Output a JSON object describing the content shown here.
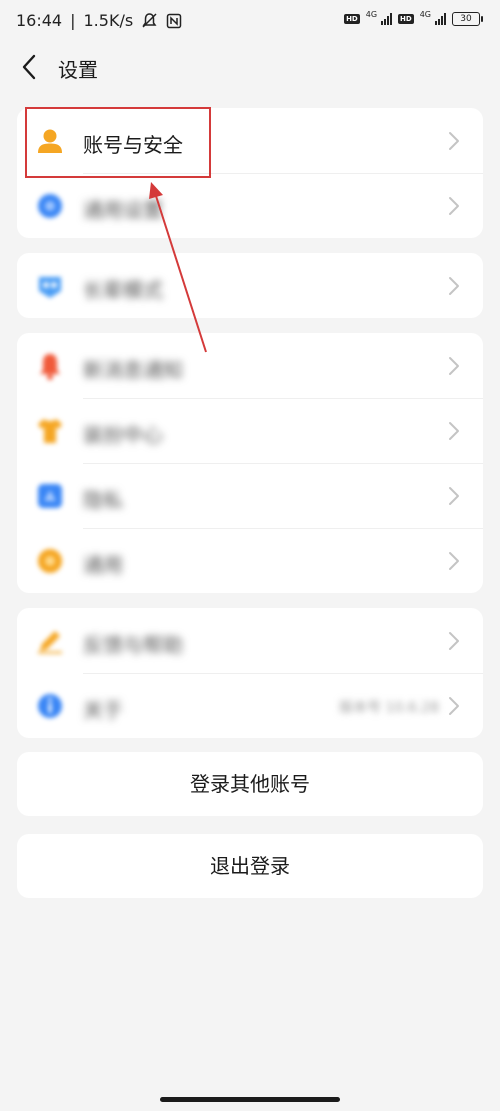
{
  "status_bar": {
    "time": "16:44",
    "speed": "1.5K/s",
    "hd1": "HD",
    "net1": "4G",
    "hd2": "HD",
    "net2": "4G",
    "battery": "30"
  },
  "header": {
    "title": "设置",
    "back_icon": "chevron-left-icon"
  },
  "groups": [
    {
      "items": [
        {
          "label": "账号与安全",
          "icon": "person-icon",
          "color": "#f5a623",
          "blurred": false
        },
        {
          "label": "通用设置",
          "icon": "gear-icon",
          "color": "#3a86f5",
          "blurred": true
        }
      ]
    },
    {
      "items": [
        {
          "label": "长辈模式",
          "icon": "heart-badge-icon",
          "color": "#4a9df5",
          "blurred": true
        }
      ]
    },
    {
      "items": [
        {
          "label": "新消息通知",
          "icon": "bell-icon",
          "color": "#f05a3a",
          "blurred": true
        },
        {
          "label": "装扮中心",
          "icon": "shirt-icon",
          "color": "#f5a623",
          "blurred": true
        },
        {
          "label": "隐私",
          "icon": "shield-icon",
          "color": "#3a86f5",
          "blurred": true
        },
        {
          "label": "通用",
          "icon": "flower-icon",
          "color": "#f5a623",
          "blurred": true
        }
      ]
    },
    {
      "items": [
        {
          "label": "反馈与帮助",
          "icon": "pencil-icon",
          "color": "#f5a623",
          "blurred": true
        },
        {
          "label": "关于",
          "icon": "info-icon",
          "color": "#3a86f5",
          "blurred": true,
          "value": "版本号 10.6.28"
        }
      ]
    }
  ],
  "actions": {
    "switch_account": "登录其他账号",
    "logout": "退出登录"
  },
  "colors": {
    "background": "#f4f4f4",
    "card": "#ffffff",
    "annotation": "#d43a3a"
  }
}
